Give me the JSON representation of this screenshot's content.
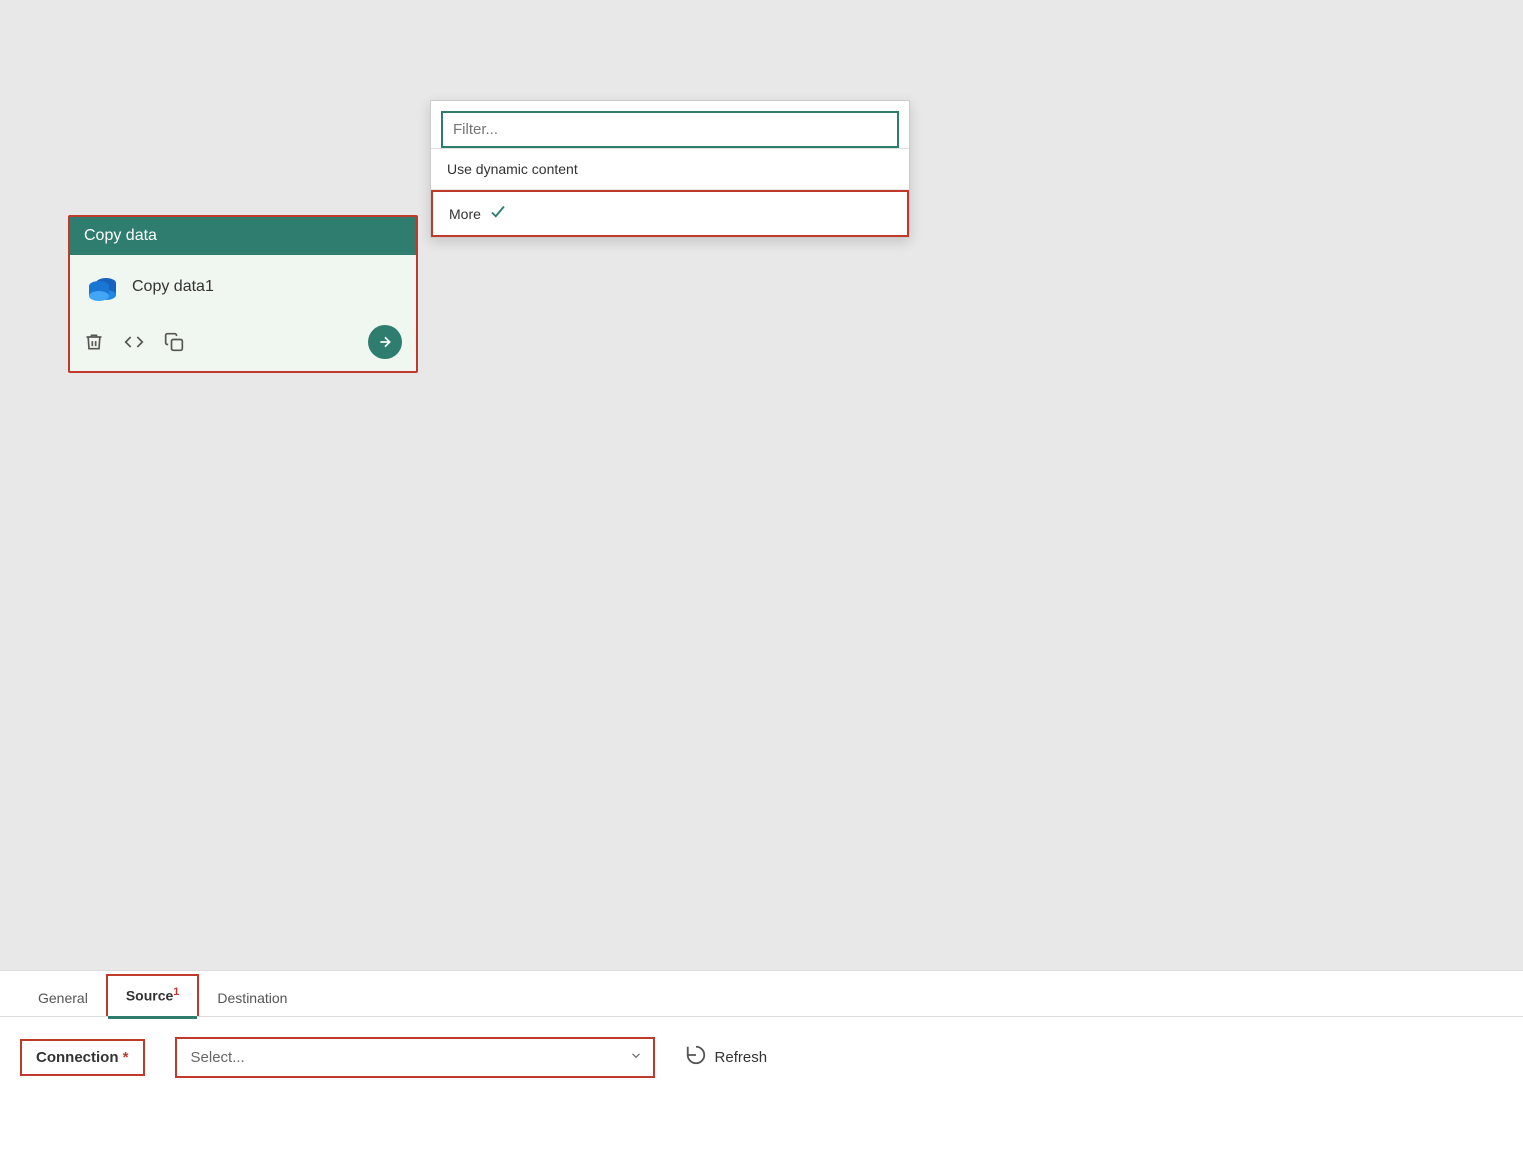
{
  "canvas": {
    "background": "#e8e8e8"
  },
  "copy_data_card": {
    "header": "Copy data",
    "item_name": "Copy data1",
    "delete_icon": "🗑",
    "code_icon": "</>",
    "copy_icon": "⧉",
    "arrow_icon": "→"
  },
  "dropdown_panel": {
    "filter_placeholder": "Filter...",
    "dynamic_content_label": "Use dynamic content",
    "more_label": "More"
  },
  "tabs": [
    {
      "id": "general",
      "label": "General",
      "active": false,
      "badge": ""
    },
    {
      "id": "source",
      "label": "Source",
      "active": true,
      "badge": "1"
    },
    {
      "id": "destination",
      "label": "Destination",
      "active": false,
      "badge": ""
    }
  ],
  "connection_section": {
    "label": "Connection",
    "required": "*",
    "select_placeholder": "Select...",
    "refresh_label": "Refresh"
  },
  "colors": {
    "teal": "#2e7d6e",
    "red_border": "#c0392b",
    "light_green_bg": "#f0f7f0"
  }
}
